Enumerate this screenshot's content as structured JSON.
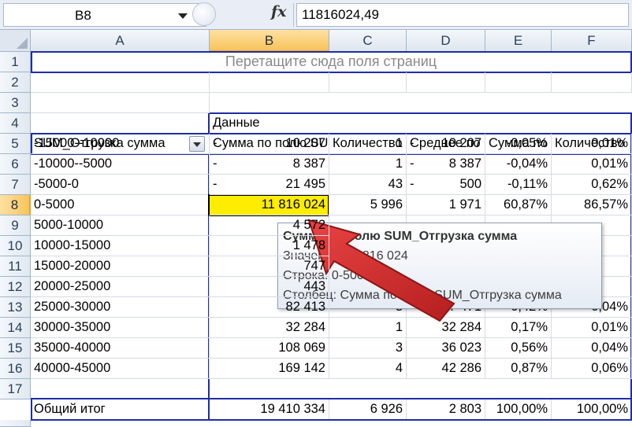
{
  "formula_bar": {
    "name_box": "B8",
    "fx_symbol": "fx",
    "value": "11816024,49"
  },
  "columns": [
    "A",
    "B",
    "C",
    "D",
    "E",
    "F"
  ],
  "selected_column": "B",
  "rows": [
    "1",
    "2",
    "3",
    "4",
    "5",
    "6",
    "7",
    "8",
    "9",
    "10",
    "11",
    "12",
    "13",
    "14",
    "15",
    "16",
    "17"
  ],
  "selected_row": "8",
  "pivot": {
    "page_drop_zone": "Перетащите сюда поля страниц",
    "data_label": "Данные",
    "row_field": "SUM_Отгрузка сумма",
    "headers": [
      "Сумма по полю SUM_Отгрузка сумма",
      "Количество",
      "Среднее по",
      "Сумма по",
      "Количество"
    ],
    "data_rows": [
      {
        "label": "-15000--10000",
        "dash_b": "-",
        "b": "10 207",
        "c": "1",
        "dash_d": "-",
        "d": "10 207",
        "e": "-0,05%",
        "f": "0,01%"
      },
      {
        "label": "-10000--5000",
        "dash_b": "-",
        "b": "8 387",
        "c": "1",
        "dash_d": "-",
        "d": "8 387",
        "e": "-0,04%",
        "f": "0,01%"
      },
      {
        "label": "-5000-0",
        "dash_b": "-",
        "b": "21 495",
        "c": "43",
        "dash_d": "-",
        "d": "500",
        "e": "-0,11%",
        "f": "0,62%"
      },
      {
        "label": "0-5000",
        "dash_b": "",
        "b": "11 816 024",
        "c": "5 996",
        "dash_d": "",
        "d": "1 971",
        "e": "60,87%",
        "f": "86,57%"
      },
      {
        "label": "5000-10000",
        "dash_b": "",
        "b": "4 572",
        "c": "",
        "dash_d": "",
        "d": "",
        "e": "",
        "f": ""
      },
      {
        "label": "10000-15000",
        "dash_b": "",
        "b": "1 478",
        "c": "",
        "dash_d": "",
        "d": "",
        "e": "",
        "f": ""
      },
      {
        "label": "15000-20000",
        "dash_b": "",
        "b": "747",
        "c": "",
        "dash_d": "",
        "d": "",
        "e": "",
        "f": ""
      },
      {
        "label": "20000-25000",
        "dash_b": "",
        "b": "443",
        "c": "",
        "dash_d": "",
        "d": "",
        "e": "",
        "f": ""
      },
      {
        "label": "25000-30000",
        "dash_b": "",
        "b": "82 413",
        "c": "3",
        "dash_d": "",
        "d": "27 471",
        "e": "0,42%",
        "f": "0,04%"
      },
      {
        "label": "30000-35000",
        "dash_b": "",
        "b": "32 284",
        "c": "1",
        "dash_d": "",
        "d": "32 284",
        "e": "0,17%",
        "f": "0,01%"
      },
      {
        "label": "35000-40000",
        "dash_b": "",
        "b": "108 069",
        "c": "3",
        "dash_d": "",
        "d": "36 023",
        "e": "0,56%",
        "f": "0,04%"
      },
      {
        "label": "40000-45000",
        "dash_b": "",
        "b": "169 142",
        "c": "4",
        "dash_d": "",
        "d": "42 286",
        "e": "0,87%",
        "f": "0,06%"
      }
    ],
    "total": {
      "label": "Общий итог",
      "b": "19 410 334",
      "c": "6 926",
      "d": "2 803",
      "e": "100,00%",
      "f": "100,00%"
    }
  },
  "tooltip": {
    "title": "Сумма по полю SUM_Отгрузка сумма",
    "value_line": "Значение: 11 816 024",
    "row_line": "Строка: 0-5000",
    "column_line": "Столбец: Сумма по полю SUM_Отгрузка сумма"
  },
  "colors": {
    "pivot_border": "#1f2ca6",
    "selection_fill": "#ffed00",
    "arrow": "#d42a2a"
  }
}
